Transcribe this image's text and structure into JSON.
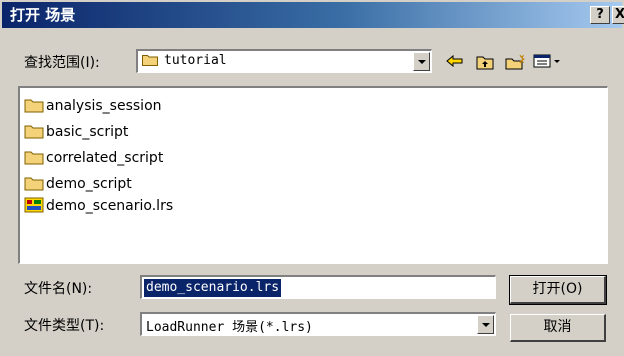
{
  "window": {
    "title": "打开 场景",
    "help_label": "?",
    "close_label": "X"
  },
  "look_in": {
    "label": "查找范围(I):",
    "value": "tutorial"
  },
  "toolbar": {
    "icons": [
      "back-icon",
      "up-folder-icon",
      "new-folder-icon",
      "view-menu-icon"
    ]
  },
  "files": [
    {
      "name": "analysis_session",
      "type": "folder"
    },
    {
      "name": "basic_script",
      "type": "folder"
    },
    {
      "name": "correlated_script",
      "type": "folder"
    },
    {
      "name": "demo_script",
      "type": "folder"
    },
    {
      "name": "demo_scenario.lrs",
      "type": "scenario-file"
    }
  ],
  "filename": {
    "label": "文件名(N):",
    "value": "demo_scenario.lrs"
  },
  "filetype": {
    "label": "文件类型(T):",
    "value": "LoadRunner 场景(*.lrs)"
  },
  "buttons": {
    "open": "打开(O)",
    "cancel": "取消"
  },
  "colors": {
    "title_start": "#0a246a",
    "title_end": "#a6caf0",
    "face": "#d4d0c8",
    "selection": "#0a246a",
    "folder": "#f4d27a"
  }
}
